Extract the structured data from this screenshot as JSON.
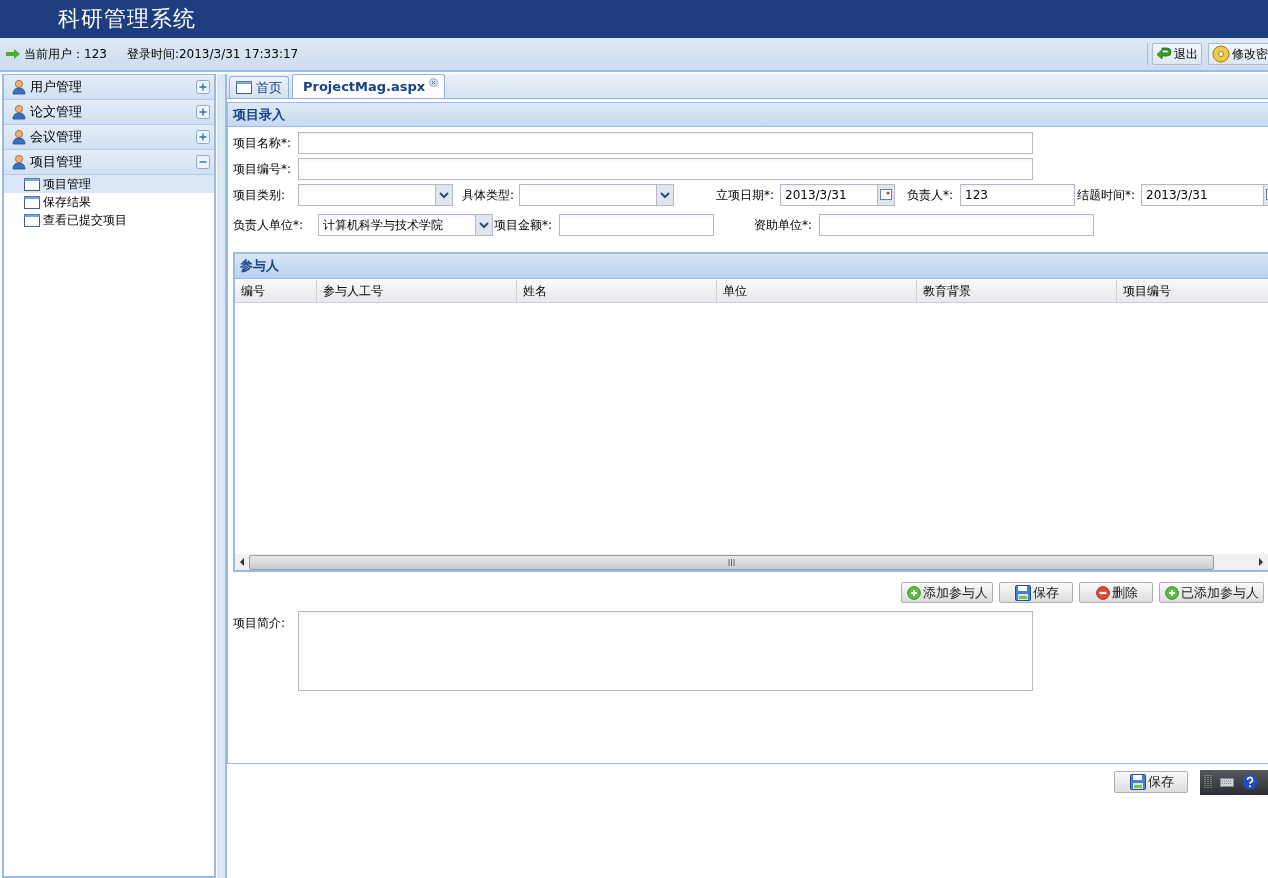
{
  "app_title": "科研管理系统",
  "user_bar": {
    "current_user": "当前用户：123",
    "login_time": "登录时间:2013/3/31 17:33:17",
    "buttons": [
      {
        "label": "退出",
        "kind": "exit"
      },
      {
        "label": "修改密",
        "kind": "password"
      }
    ]
  },
  "sidebar": {
    "groups": [
      {
        "label": "用户管理",
        "expanded": false
      },
      {
        "label": "论文管理",
        "expanded": false
      },
      {
        "label": "会议管理",
        "expanded": false
      },
      {
        "label": "项目管理",
        "expanded": true,
        "children": [
          {
            "label": "项目管理",
            "selected": true
          },
          {
            "label": "保存结果",
            "selected": false
          },
          {
            "label": "查看已提交项目",
            "selected": false
          }
        ]
      }
    ]
  },
  "tabs": [
    {
      "label": "首页",
      "selected": false,
      "closable": false
    },
    {
      "label": "ProjectMag.aspx",
      "selected": true,
      "closable": true
    }
  ],
  "form": {
    "title": "项目录入",
    "rows": [
      [
        {
          "label": "项目名称*:",
          "kind": "text"
        }
      ],
      [
        {
          "label": "项目编号*:",
          "kind": "text"
        }
      ],
      [
        {
          "label": "项目类别:",
          "kind": "select"
        },
        {
          "label": "具体类型:",
          "kind": "select"
        },
        {
          "label": "立项日期*:",
          "kind": "date",
          "value": "2013/3/31"
        },
        {
          "label": "负责人*:",
          "kind": "text",
          "value": "123"
        },
        {
          "label": "结题时间*:",
          "kind": "date",
          "value": "2013/3/31"
        }
      ],
      [
        {
          "label": "负责人单位*:",
          "kind": "select",
          "value": "计算机科学与技术学院"
        },
        {
          "label": "项目金额*:",
          "kind": "text"
        },
        {
          "label": "资助单位*:",
          "kind": "text"
        }
      ]
    ]
  },
  "participants": {
    "title": "参与人",
    "columns": [
      "编号",
      "参与人工号",
      "姓名",
      "单位",
      "教育背景",
      "项目编号"
    ]
  },
  "participant_buttons": [
    {
      "label": "添加参与人",
      "kind": "add"
    },
    {
      "label": "保存",
      "kind": "save"
    },
    {
      "label": "删除",
      "kind": "delete"
    },
    {
      "label": "已添加参与人",
      "kind": "add"
    }
  ],
  "description": {
    "label": "项目简介:"
  },
  "footer_buttons": [
    {
      "label": "保存",
      "kind": "save"
    }
  ]
}
